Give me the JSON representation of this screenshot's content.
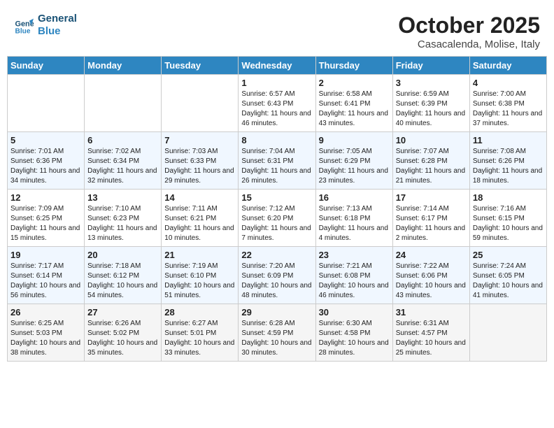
{
  "header": {
    "logo_line1": "General",
    "logo_line2": "Blue",
    "month": "October 2025",
    "location": "Casacalenda, Molise, Italy"
  },
  "weekdays": [
    "Sunday",
    "Monday",
    "Tuesday",
    "Wednesday",
    "Thursday",
    "Friday",
    "Saturday"
  ],
  "weeks": [
    [
      {
        "day": "",
        "info": ""
      },
      {
        "day": "",
        "info": ""
      },
      {
        "day": "",
        "info": ""
      },
      {
        "day": "1",
        "info": "Sunrise: 6:57 AM\nSunset: 6:43 PM\nDaylight: 11 hours and 46 minutes."
      },
      {
        "day": "2",
        "info": "Sunrise: 6:58 AM\nSunset: 6:41 PM\nDaylight: 11 hours and 43 minutes."
      },
      {
        "day": "3",
        "info": "Sunrise: 6:59 AM\nSunset: 6:39 PM\nDaylight: 11 hours and 40 minutes."
      },
      {
        "day": "4",
        "info": "Sunrise: 7:00 AM\nSunset: 6:38 PM\nDaylight: 11 hours and 37 minutes."
      }
    ],
    [
      {
        "day": "5",
        "info": "Sunrise: 7:01 AM\nSunset: 6:36 PM\nDaylight: 11 hours and 34 minutes."
      },
      {
        "day": "6",
        "info": "Sunrise: 7:02 AM\nSunset: 6:34 PM\nDaylight: 11 hours and 32 minutes."
      },
      {
        "day": "7",
        "info": "Sunrise: 7:03 AM\nSunset: 6:33 PM\nDaylight: 11 hours and 29 minutes."
      },
      {
        "day": "8",
        "info": "Sunrise: 7:04 AM\nSunset: 6:31 PM\nDaylight: 11 hours and 26 minutes."
      },
      {
        "day": "9",
        "info": "Sunrise: 7:05 AM\nSunset: 6:29 PM\nDaylight: 11 hours and 23 minutes."
      },
      {
        "day": "10",
        "info": "Sunrise: 7:07 AM\nSunset: 6:28 PM\nDaylight: 11 hours and 21 minutes."
      },
      {
        "day": "11",
        "info": "Sunrise: 7:08 AM\nSunset: 6:26 PM\nDaylight: 11 hours and 18 minutes."
      }
    ],
    [
      {
        "day": "12",
        "info": "Sunrise: 7:09 AM\nSunset: 6:25 PM\nDaylight: 11 hours and 15 minutes."
      },
      {
        "day": "13",
        "info": "Sunrise: 7:10 AM\nSunset: 6:23 PM\nDaylight: 11 hours and 13 minutes."
      },
      {
        "day": "14",
        "info": "Sunrise: 7:11 AM\nSunset: 6:21 PM\nDaylight: 11 hours and 10 minutes."
      },
      {
        "day": "15",
        "info": "Sunrise: 7:12 AM\nSunset: 6:20 PM\nDaylight: 11 hours and 7 minutes."
      },
      {
        "day": "16",
        "info": "Sunrise: 7:13 AM\nSunset: 6:18 PM\nDaylight: 11 hours and 4 minutes."
      },
      {
        "day": "17",
        "info": "Sunrise: 7:14 AM\nSunset: 6:17 PM\nDaylight: 11 hours and 2 minutes."
      },
      {
        "day": "18",
        "info": "Sunrise: 7:16 AM\nSunset: 6:15 PM\nDaylight: 10 hours and 59 minutes."
      }
    ],
    [
      {
        "day": "19",
        "info": "Sunrise: 7:17 AM\nSunset: 6:14 PM\nDaylight: 10 hours and 56 minutes."
      },
      {
        "day": "20",
        "info": "Sunrise: 7:18 AM\nSunset: 6:12 PM\nDaylight: 10 hours and 54 minutes."
      },
      {
        "day": "21",
        "info": "Sunrise: 7:19 AM\nSunset: 6:10 PM\nDaylight: 10 hours and 51 minutes."
      },
      {
        "day": "22",
        "info": "Sunrise: 7:20 AM\nSunset: 6:09 PM\nDaylight: 10 hours and 48 minutes."
      },
      {
        "day": "23",
        "info": "Sunrise: 7:21 AM\nSunset: 6:08 PM\nDaylight: 10 hours and 46 minutes."
      },
      {
        "day": "24",
        "info": "Sunrise: 7:22 AM\nSunset: 6:06 PM\nDaylight: 10 hours and 43 minutes."
      },
      {
        "day": "25",
        "info": "Sunrise: 7:24 AM\nSunset: 6:05 PM\nDaylight: 10 hours and 41 minutes."
      }
    ],
    [
      {
        "day": "26",
        "info": "Sunrise: 6:25 AM\nSunset: 5:03 PM\nDaylight: 10 hours and 38 minutes."
      },
      {
        "day": "27",
        "info": "Sunrise: 6:26 AM\nSunset: 5:02 PM\nDaylight: 10 hours and 35 minutes."
      },
      {
        "day": "28",
        "info": "Sunrise: 6:27 AM\nSunset: 5:01 PM\nDaylight: 10 hours and 33 minutes."
      },
      {
        "day": "29",
        "info": "Sunrise: 6:28 AM\nSunset: 4:59 PM\nDaylight: 10 hours and 30 minutes."
      },
      {
        "day": "30",
        "info": "Sunrise: 6:30 AM\nSunset: 4:58 PM\nDaylight: 10 hours and 28 minutes."
      },
      {
        "day": "31",
        "info": "Sunrise: 6:31 AM\nSunset: 4:57 PM\nDaylight: 10 hours and 25 minutes."
      },
      {
        "day": "",
        "info": ""
      }
    ]
  ]
}
